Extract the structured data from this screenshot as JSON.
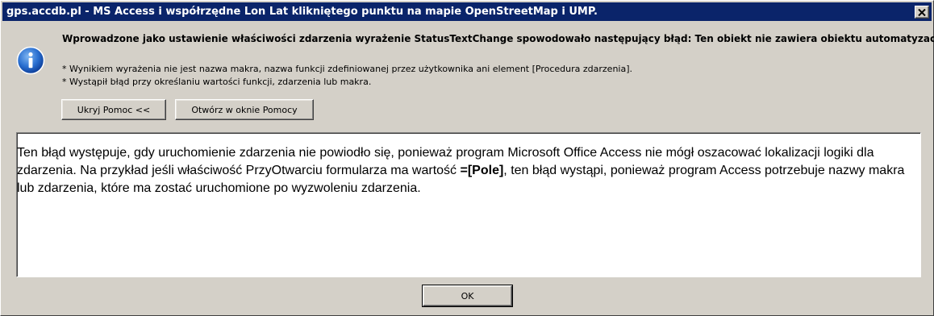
{
  "window": {
    "title": "gps.accdb.pl - MS Access i współrzędne Lon Lat klikniętego punktu na mapie OpenStreetMap i UMP."
  },
  "message": {
    "title": "Wprowadzone jako ustawienie właściwości zdarzenia wyrażenie StatusTextChange spowodowało następujący błąd: Ten obiekt nie zawiera obiektu automatyzacji |.",
    "bullets": [
      "*  Wynikiem wyrażenia nie jest nazwa makra, nazwa funkcji zdefiniowanej przez użytkownika ani element [Procedura zdarzenia].",
      "*  Wystąpił błąd przy określaniu wartości funkcji, zdarzenia lub makra."
    ]
  },
  "buttons": {
    "hide_help": "Ukryj Pomoc <<",
    "open_help": "Otwórz w oknie Pomocy",
    "ok": "OK"
  },
  "help": {
    "text_before": "Ten błąd występuje, gdy uruchomienie zdarzenia nie powiodło się, ponieważ program Microsoft Office Access nie mógł oszacować lokalizacji logiki dla zdarzenia. Na przykład jeśli właściwość PrzyOtwarciu formularza ma wartość ",
    "bold_value": "=[Pole]",
    "text_after": ", ten błąd wystąpi, ponieważ program Access potrzebuje nazwy makra lub zdarzenia, które ma zostać uruchomione po wyzwoleniu zdarzenia."
  },
  "icons": {
    "info": "info-icon",
    "close": "close-icon"
  },
  "colors": {
    "titlebar": "#0a246a",
    "dialog_bg": "#d4d0c8",
    "icon_blue": "#1f6fd0"
  }
}
